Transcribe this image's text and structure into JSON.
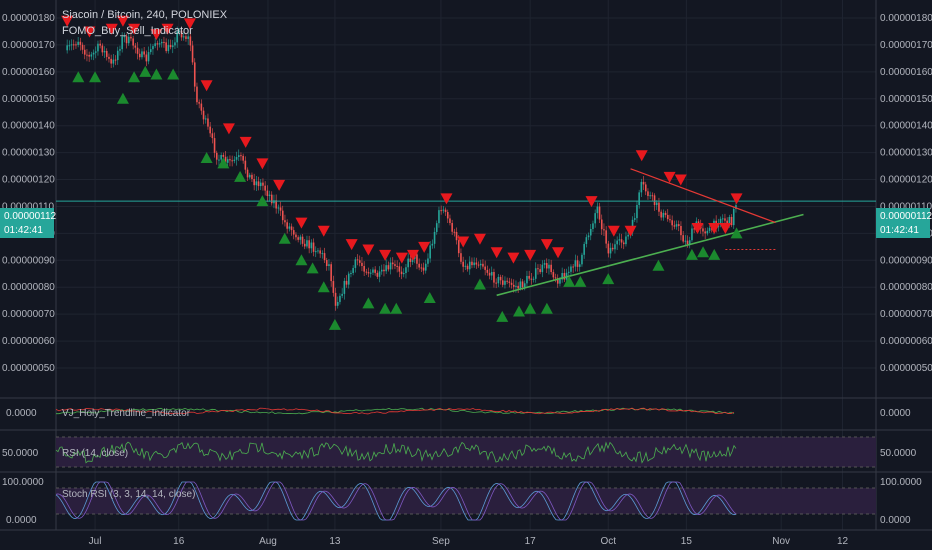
{
  "header": {
    "title": "Siacoin / Bitcoin, 240, POLONIEX",
    "indicator": "FOMO_Buy_Sell_Indicator"
  },
  "price_badge": {
    "price": "0.00000112",
    "countdown": "01:42:41"
  },
  "panes": {
    "trend": {
      "label": "VJ_Holy_Trendline_Indicator",
      "value_label": "0.0000"
    },
    "rsi": {
      "label": "RSI (14, close)",
      "value_label": "50.0000"
    },
    "stoch": {
      "label": "Stoch RSI (3, 3, 14, 14, close)",
      "top_label": "100.0000",
      "bottom_label": "0.0000"
    }
  },
  "colors": {
    "background": "#131722",
    "up": "#26a69a",
    "down": "#ef5350",
    "buy": "#1b8a2e",
    "sell": "#e8191e",
    "support": "#4caf50",
    "resistance": "#e53935",
    "rsi": "#4caf50",
    "stoch": "#7e57c2",
    "badge": "#26a69a"
  },
  "chart_data": [
    {
      "type": "line",
      "title": "Siacoin / Bitcoin, 240, POLONIEX",
      "x_labels": [
        "Jul",
        "16",
        "Aug",
        "13",
        "Sep",
        "17",
        "Oct",
        "15",
        "Nov",
        "12"
      ],
      "y_ticks": [
        "0.00000180",
        "0.00000170",
        "0.00000160",
        "0.00000150",
        "0.00000140",
        "0.00000130",
        "0.00000120",
        "0.00000110",
        "0.00000100",
        "0.00000090",
        "0.00000080",
        "0.00000070",
        "0.00000060",
        "0.00000050"
      ],
      "ylim": [
        5e-07,
        1.8e-06
      ],
      "series": [
        {
          "dates": [
            "2018-06-26",
            "2018-06-28",
            "2018-06-30",
            "2018-07-02",
            "2018-07-04",
            "2018-07-06",
            "2018-07-08",
            "2018-07-10",
            "2018-07-12",
            "2018-07-14",
            "2018-07-16",
            "2018-07-18",
            "2018-07-19",
            "2018-07-21",
            "2018-07-23",
            "2018-07-25",
            "2018-07-27",
            "2018-07-29",
            "2018-07-31",
            "2018-08-02",
            "2018-08-04",
            "2018-08-06",
            "2018-08-08",
            "2018-08-10",
            "2018-08-12",
            "2018-08-13",
            "2018-08-15",
            "2018-08-17",
            "2018-08-19",
            "2018-08-21",
            "2018-08-23",
            "2018-08-25",
            "2018-08-27",
            "2018-08-29",
            "2018-09-01",
            "2018-09-03",
            "2018-09-05",
            "2018-09-08",
            "2018-09-10",
            "2018-09-12",
            "2018-09-15",
            "2018-09-17",
            "2018-09-20",
            "2018-09-22",
            "2018-09-24",
            "2018-09-26",
            "2018-09-29",
            "2018-10-01",
            "2018-10-03",
            "2018-10-05",
            "2018-10-07",
            "2018-10-09",
            "2018-10-11",
            "2018-10-13",
            "2018-10-15",
            "2018-10-17",
            "2018-10-19",
            "2018-10-21",
            "2018-10-23",
            "2018-10-24"
          ],
          "close": [
            1.68e-06,
            1.72e-06,
            1.65e-06,
            1.7e-06,
            1.62e-06,
            1.73e-06,
            1.7e-06,
            1.64e-06,
            1.72e-06,
            1.68e-06,
            1.75e-06,
            1.72e-06,
            1.52e-06,
            1.4e-06,
            1.28e-06,
            1.26e-06,
            1.28e-06,
            1.2e-06,
            1.18e-06,
            1.12e-06,
            1.04e-06,
            1e-06,
            9.6e-07,
            9.4e-07,
            8.8e-07,
            7.4e-07,
            8.2e-07,
            9e-07,
            8.6e-07,
            8.4e-07,
            8.8e-07,
            8.6e-07,
            9.2e-07,
            8.6e-07,
            1.1e-06,
            1.02e-06,
            8.8e-07,
            9e-07,
            8.4e-07,
            8.2e-07,
            8e-07,
            8.4e-07,
            8.8e-07,
            8.3e-07,
            8.6e-07,
            9e-07,
            1.1e-06,
            9.4e-07,
            9.6e-07,
            1e-06,
            1.18e-06,
            1.12e-06,
            1.06e-06,
            1.04e-06,
            9.6e-07,
            1.04e-06,
            1e-06,
            1.06e-06,
            1.04e-06,
            1.12e-06
          ]
        }
      ],
      "trendlines": {
        "support": {
          "from": [
            "2018-09-11",
            7.7e-07
          ],
          "to": [
            "2018-11-05",
            1.07e-06
          ]
        },
        "resistance": {
          "from": [
            "2018-10-05",
            1.24e-06
          ],
          "to": [
            "2018-10-31",
            1.04e-06
          ]
        },
        "dotted_level": {
          "from": [
            "2018-10-22",
            9.4e-07
          ],
          "to": [
            "2018-10-31",
            9.4e-07
          ]
        }
      },
      "buy_signals": [
        [
          "2018-06-28",
          1.58e-06
        ],
        [
          "2018-07-01",
          1.58e-06
        ],
        [
          "2018-07-06",
          1.5e-06
        ],
        [
          "2018-07-08",
          1.58e-06
        ],
        [
          "2018-07-10",
          1.6e-06
        ],
        [
          "2018-07-12",
          1.59e-06
        ],
        [
          "2018-07-15",
          1.59e-06
        ],
        [
          "2018-07-21",
          1.28e-06
        ],
        [
          "2018-07-24",
          1.26e-06
        ],
        [
          "2018-07-27",
          1.21e-06
        ],
        [
          "2018-07-31",
          1.12e-06
        ],
        [
          "2018-08-04",
          9.8e-07
        ],
        [
          "2018-08-07",
          9e-07
        ],
        [
          "2018-08-09",
          8.7e-07
        ],
        [
          "2018-08-11",
          8e-07
        ],
        [
          "2018-08-13",
          6.6e-07
        ],
        [
          "2018-08-19",
          7.4e-07
        ],
        [
          "2018-08-22",
          7.2e-07
        ],
        [
          "2018-08-24",
          7.2e-07
        ],
        [
          "2018-08-30",
          7.6e-07
        ],
        [
          "2018-09-08",
          8.1e-07
        ],
        [
          "2018-09-12",
          6.9e-07
        ],
        [
          "2018-09-15",
          7.1e-07
        ],
        [
          "2018-09-17",
          7.2e-07
        ],
        [
          "2018-09-20",
          7.2e-07
        ],
        [
          "2018-09-24",
          8.2e-07
        ],
        [
          "2018-09-26",
          8.2e-07
        ],
        [
          "2018-10-01",
          8.3e-07
        ],
        [
          "2018-10-10",
          8.8e-07
        ],
        [
          "2018-10-16",
          9.2e-07
        ],
        [
          "2018-10-18",
          9.3e-07
        ],
        [
          "2018-10-20",
          9.2e-07
        ],
        [
          "2018-10-24",
          1e-06
        ]
      ],
      "sell_signals": [
        [
          "2018-06-26",
          1.79e-06
        ],
        [
          "2018-06-30",
          1.75e-06
        ],
        [
          "2018-07-04",
          1.76e-06
        ],
        [
          "2018-07-06",
          1.79e-06
        ],
        [
          "2018-07-08",
          1.76e-06
        ],
        [
          "2018-07-12",
          1.74e-06
        ],
        [
          "2018-07-14",
          1.76e-06
        ],
        [
          "2018-07-18",
          1.78e-06
        ],
        [
          "2018-07-21",
          1.55e-06
        ],
        [
          "2018-07-25",
          1.39e-06
        ],
        [
          "2018-07-28",
          1.34e-06
        ],
        [
          "2018-07-31",
          1.26e-06
        ],
        [
          "2018-08-03",
          1.18e-06
        ],
        [
          "2018-08-07",
          1.04e-06
        ],
        [
          "2018-08-11",
          1.01e-06
        ],
        [
          "2018-08-16",
          9.6e-07
        ],
        [
          "2018-08-19",
          9.4e-07
        ],
        [
          "2018-08-22",
          9.2e-07
        ],
        [
          "2018-08-25",
          9.1e-07
        ],
        [
          "2018-08-27",
          9.2e-07
        ],
        [
          "2018-08-29",
          9.5e-07
        ],
        [
          "2018-09-02",
          1.13e-06
        ],
        [
          "2018-09-05",
          9.7e-07
        ],
        [
          "2018-09-08",
          9.8e-07
        ],
        [
          "2018-09-11",
          9.3e-07
        ],
        [
          "2018-09-14",
          9.1e-07
        ],
        [
          "2018-09-17",
          9.2e-07
        ],
        [
          "2018-09-20",
          9.6e-07
        ],
        [
          "2018-09-22",
          9.3e-07
        ],
        [
          "2018-09-28",
          1.12e-06
        ],
        [
          "2018-10-02",
          1.01e-06
        ],
        [
          "2018-10-05",
          1.01e-06
        ],
        [
          "2018-10-07",
          1.29e-06
        ],
        [
          "2018-10-12",
          1.21e-06
        ],
        [
          "2018-10-14",
          1.2e-06
        ],
        [
          "2018-10-17",
          1.02e-06
        ],
        [
          "2018-10-20",
          1.02e-06
        ],
        [
          "2018-10-22",
          1.02e-06
        ],
        [
          "2018-10-24",
          1.13e-06
        ]
      ]
    },
    {
      "type": "line",
      "title": "VJ_Holy_Trendline_Indicator",
      "y_ticks": [
        "0.0000"
      ]
    },
    {
      "type": "line",
      "title": "RSI (14, close)",
      "y_ticks": [
        "50.0000"
      ],
      "ylim": [
        30,
        70
      ],
      "band": [
        30,
        70
      ]
    },
    {
      "type": "line",
      "title": "Stoch RSI (3, 3, 14, 14, close)",
      "y_ticks": [
        "100.0000",
        "0.0000"
      ],
      "ylim": [
        0,
        100
      ],
      "band": [
        20,
        80
      ]
    }
  ]
}
